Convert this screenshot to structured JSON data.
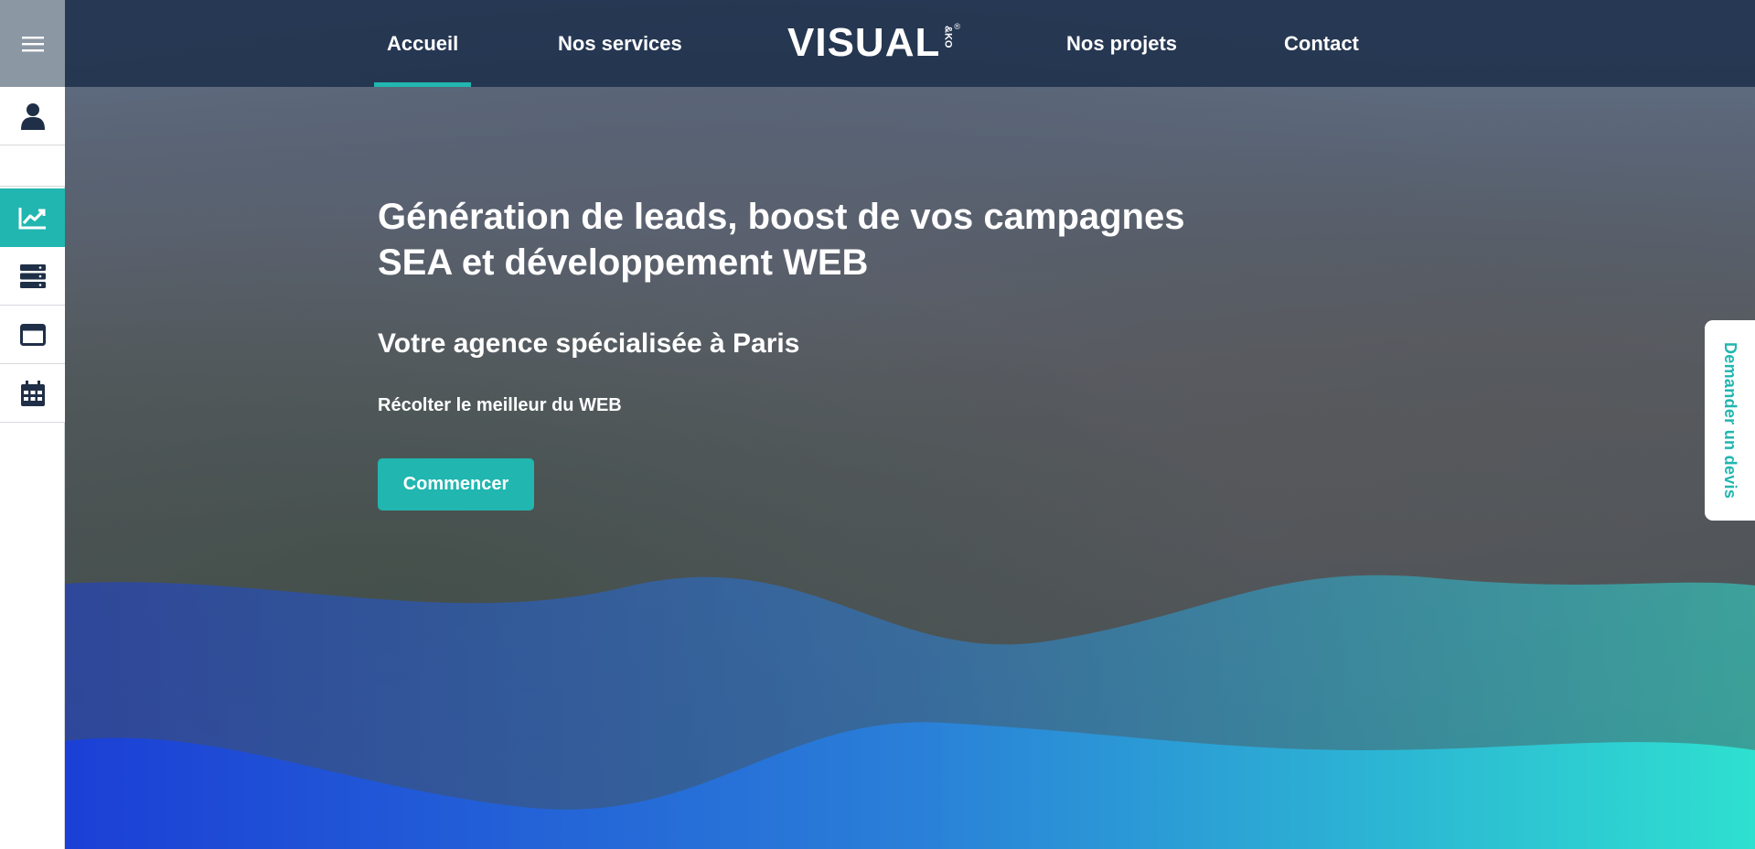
{
  "header": {
    "nav": [
      {
        "label": "Accueil",
        "active": true
      },
      {
        "label": "Nos services",
        "active": false
      },
      {
        "label": "Nos projets",
        "active": false
      },
      {
        "label": "Contact",
        "active": false
      }
    ],
    "logo": {
      "text": "VISUAL",
      "sub": "&KO",
      "reg": "®"
    }
  },
  "sidebar": {
    "items": [
      {
        "icon": "menu-icon"
      },
      {
        "icon": "user-icon"
      },
      {
        "icon": "chart-line-icon",
        "active": true
      },
      {
        "icon": "server-icon"
      },
      {
        "icon": "window-icon"
      },
      {
        "icon": "calendar-icon"
      }
    ]
  },
  "hero": {
    "title": "Génération de leads, boost de vos campagnes SEA et développement WEB",
    "subtitle": "Votre agence spécialisée à Paris",
    "tagline": "Récolter le meilleur du WEB",
    "cta_label": "Commencer"
  },
  "side_tab": {
    "label": "Demander un devis"
  },
  "colors": {
    "accent": "#21b6b0",
    "header_bg": "#1a2c48",
    "wave_start": "#1b3fd6",
    "wave_end": "#2ee0d0"
  }
}
